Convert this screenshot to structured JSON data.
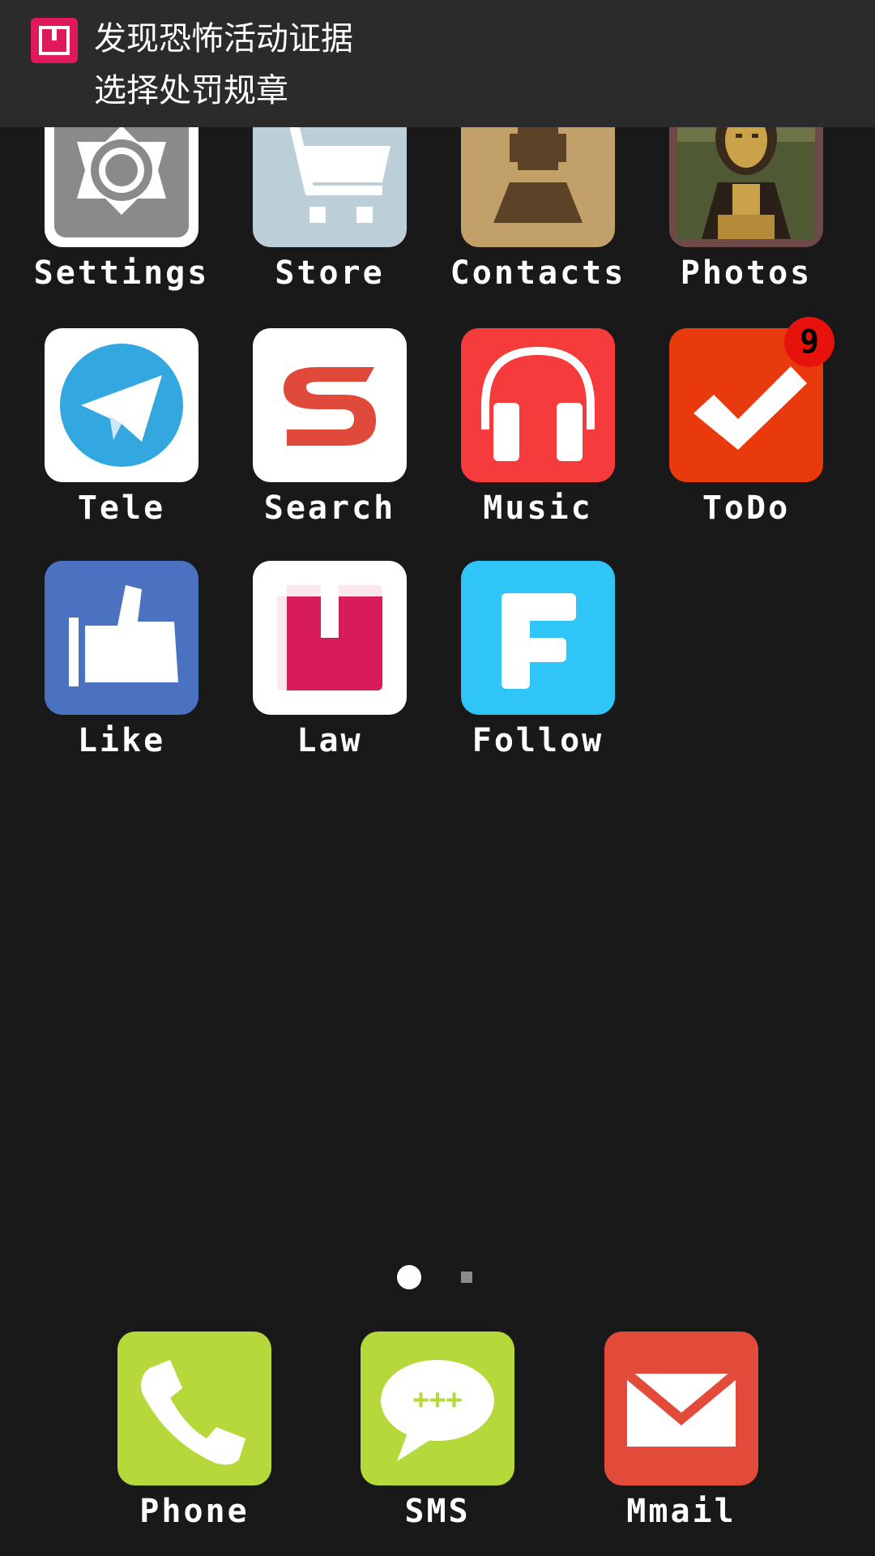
{
  "notification": {
    "title": "发现恐怖活动证据",
    "subtitle": "选择处罚规章",
    "icon": "law-book-icon"
  },
  "apps": [
    {
      "label": "Settings",
      "icon": "gear-icon"
    },
    {
      "label": "Store",
      "icon": "shopping-cart-icon"
    },
    {
      "label": "Contacts",
      "icon": "person-icon"
    },
    {
      "label": "Photos",
      "icon": "portrait-painting-icon"
    },
    {
      "label": "Tele",
      "icon": "paper-plane-icon"
    },
    {
      "label": "Search",
      "icon": "s-logo-icon"
    },
    {
      "label": "Music",
      "icon": "headphones-icon"
    },
    {
      "label": "ToDo",
      "icon": "checkmark-icon",
      "badge": "9"
    },
    {
      "label": "Like",
      "icon": "thumbs-up-icon"
    },
    {
      "label": "Law",
      "icon": "law-book-icon"
    },
    {
      "label": "Follow",
      "icon": "f-logo-icon"
    }
  ],
  "page_indicator": {
    "pages": 2,
    "current": 1
  },
  "dock": [
    {
      "label": "Phone",
      "icon": "phone-handset-icon"
    },
    {
      "label": "SMS",
      "icon": "speech-bubble-icon"
    },
    {
      "label": "Mmail",
      "icon": "envelope-icon"
    }
  ],
  "colors": {
    "background": "#191919",
    "notification_bar": "#2b2b2b",
    "badge": "#e8120c"
  }
}
